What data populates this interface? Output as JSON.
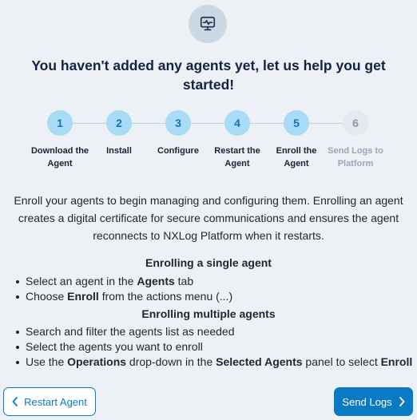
{
  "hero": {
    "icon": "monitor-activity-icon"
  },
  "title": "You haven't added any agents yet, let us help you get started!",
  "steps": [
    {
      "number": "1",
      "label": "Download the Agent",
      "state": "complete"
    },
    {
      "number": "2",
      "label": "Install",
      "state": "complete"
    },
    {
      "number": "3",
      "label": "Configure",
      "state": "complete"
    },
    {
      "number": "4",
      "label": "Restart the Agent",
      "state": "complete"
    },
    {
      "number": "5",
      "label": "Enroll the Agent",
      "state": "current"
    },
    {
      "number": "6",
      "label": "Send Logs to Platform",
      "state": "pending"
    }
  ],
  "intro": "Enroll your agents to begin managing and configuring them. Enrolling an agent creates a digital certificate for secure communications and ensures the agent reconnects to NXLog Platform when it restarts.",
  "single": {
    "title": "Enrolling a single agent",
    "items": [
      [
        {
          "t": "Select an agent in the "
        },
        {
          "t": "Agents",
          "b": true
        },
        {
          "t": " tab"
        }
      ],
      [
        {
          "t": "Choose "
        },
        {
          "t": "Enroll",
          "b": true
        },
        {
          "t": " from the actions menu (...)"
        }
      ]
    ]
  },
  "multiple": {
    "title": "Enrolling multiple agents",
    "items": [
      [
        {
          "t": "Search and filter the agents list as needed"
        }
      ],
      [
        {
          "t": "Select the agents you want to enroll"
        }
      ],
      [
        {
          "t": "Use the "
        },
        {
          "t": "Operations",
          "b": true
        },
        {
          "t": " drop-down in the "
        },
        {
          "t": "Selected Agents",
          "b": true
        },
        {
          "t": " panel to select "
        },
        {
          "t": "Enroll",
          "b": true
        }
      ]
    ]
  },
  "buttons": {
    "back_label": "Restart Agent",
    "back_icon": "chevron-left-icon",
    "next_label": "Send Logs",
    "next_icon": "chevron-right-icon"
  },
  "colors": {
    "accent": "#0a7bc2",
    "step_complete_bg": "#a7dbf6",
    "step_pending_bg": "#e4e9ef",
    "background": "#edf1f6"
  }
}
